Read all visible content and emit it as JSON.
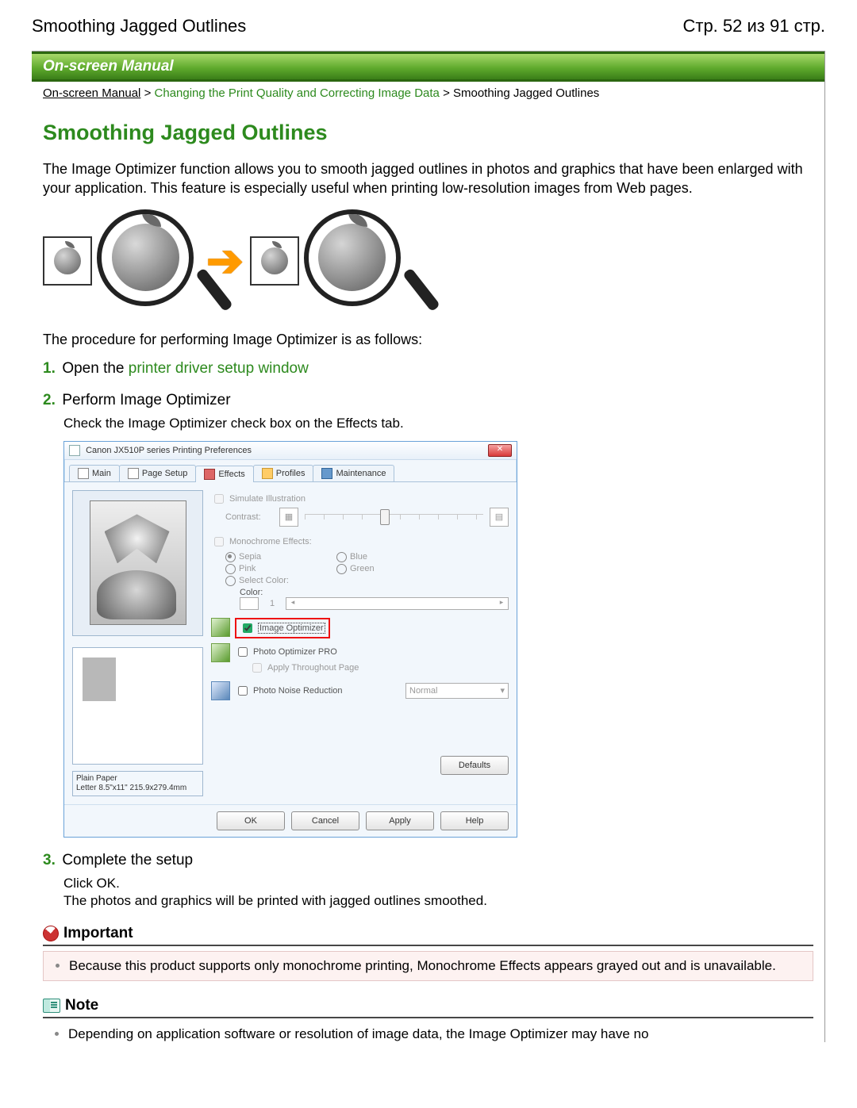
{
  "header": {
    "doc_title": "Smoothing Jagged Outlines",
    "page_counter": "Стр. 52 из 91 стр."
  },
  "manual_banner": "On-screen Manual",
  "breadcrumb": {
    "first": "On-screen Manual",
    "second": "Changing the Print Quality and Correcting Image Data",
    "last": "Smoothing Jagged Outlines",
    "sep": " > "
  },
  "title": "Smoothing Jagged Outlines",
  "intro": "The Image Optimizer function allows you to smooth jagged outlines in photos and graphics that have been enlarged with your application. This feature is especially useful when printing low-resolution images from Web pages.",
  "procedure_lead": "The procedure for performing Image Optimizer is as follows:",
  "steps": {
    "s1": {
      "num": "1.",
      "text_a": "Open the ",
      "link": "printer driver setup window"
    },
    "s2": {
      "num": "2.",
      "title": "Perform Image Optimizer",
      "desc": "Check the Image Optimizer check box on the Effects tab."
    },
    "s3": {
      "num": "3.",
      "title": "Complete the setup",
      "desc1": "Click OK.",
      "desc2": "The photos and graphics will be printed with jagged outlines smoothed."
    }
  },
  "dialog": {
    "title": "Canon JX510P series Printing Preferences",
    "tabs": {
      "main": "Main",
      "page_setup": "Page Setup",
      "effects": "Effects",
      "profiles": "Profiles",
      "maintenance": "Maintenance"
    },
    "simulate": "Simulate Illustration",
    "contrast": "Contrast:",
    "mono": "Monochrome Effects:",
    "sepia": "Sepia",
    "blue": "Blue",
    "pink": "Pink",
    "green": "Green",
    "select_color": "Select Color:",
    "color": "Color:",
    "color_num": "1",
    "image_opt": "Image Optimizer",
    "photo_opt": "Photo Optimizer PRO",
    "apply_throughout": "Apply Throughout Page",
    "noise": "Photo Noise Reduction",
    "noise_level": "Normal",
    "paper": {
      "l1": "Plain Paper",
      "l2": "Letter 8.5\"x11\" 215.9x279.4mm"
    },
    "defaults": "Defaults",
    "buttons": {
      "ok": "OK",
      "cancel": "Cancel",
      "apply": "Apply",
      "help": "Help"
    }
  },
  "important": {
    "title": "Important",
    "item": "Because this product supports only monochrome printing, Monochrome Effects appears grayed out and is unavailable."
  },
  "note": {
    "title": "Note",
    "item": "Depending on application software or resolution of image data, the Image Optimizer may have no"
  }
}
